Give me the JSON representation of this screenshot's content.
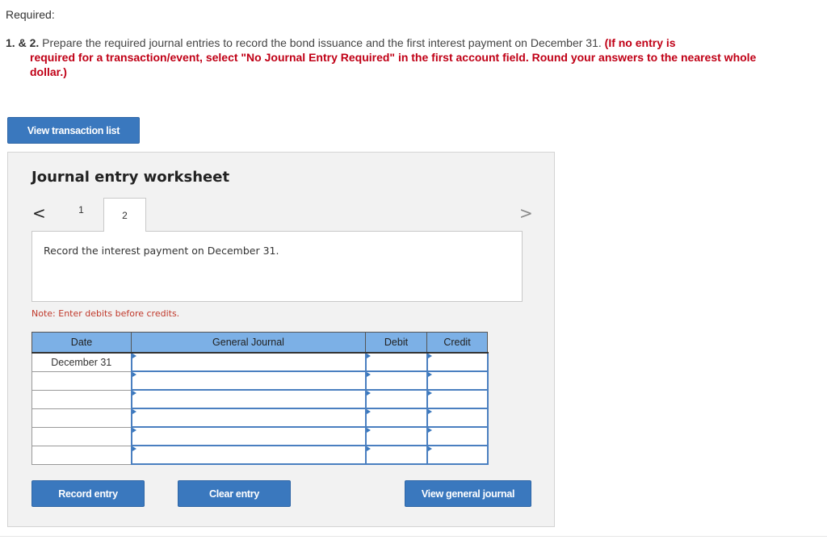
{
  "required_label": "Required:",
  "instructions": {
    "number": "1. & 2.",
    "text": "Prepare the required journal entries to record the bond issuance and the first interest payment on December 31.",
    "red_line1": "(If no entry is",
    "red_rest": "required for a transaction/event, select \"No Journal Entry Required\" in the first account field. Round your answers to the nearest whole dollar.)"
  },
  "buttons": {
    "view_transaction_list": "View transaction list",
    "record_entry": "Record entry",
    "clear_entry": "Clear entry",
    "view_general_journal": "View general journal"
  },
  "worksheet": {
    "title": "Journal entry worksheet",
    "prev_icon": "<",
    "next_icon": ">",
    "tabs": [
      {
        "label": "1"
      },
      {
        "label": "2",
        "active": true
      }
    ],
    "description": "Record the interest payment on December 31.",
    "note": "Note: Enter debits before credits."
  },
  "table": {
    "headers": [
      "Date",
      "General Journal",
      "Debit",
      "Credit"
    ],
    "rows": [
      {
        "date": "December 31",
        "account": "",
        "debit": "",
        "credit": ""
      },
      {
        "date": "",
        "account": "",
        "debit": "",
        "credit": ""
      },
      {
        "date": "",
        "account": "",
        "debit": "",
        "credit": ""
      },
      {
        "date": "",
        "account": "",
        "debit": "",
        "credit": ""
      },
      {
        "date": "",
        "account": "",
        "debit": "",
        "credit": ""
      },
      {
        "date": "",
        "account": "",
        "debit": "",
        "credit": ""
      }
    ]
  },
  "colors": {
    "button_blue": "#3a78be",
    "header_blue": "#7cb0e6",
    "instruction_red": "#c00016"
  }
}
